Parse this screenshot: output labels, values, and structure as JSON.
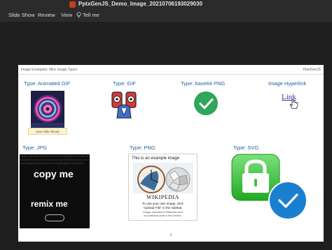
{
  "window": {
    "doc_title": "PptxGenJS_Demo_Image_20210706193029030"
  },
  "ribbon": {
    "tabs": [
      "Slide Show",
      "Review",
      "View"
    ],
    "tell_me": "Tell me"
  },
  "slide": {
    "header_left": "Image Examples: Misc Image Types",
    "header_right": "PptxGenJS",
    "labels": {
      "animated_gif": "Type: Animated GIF",
      "gif": "Type: GIF",
      "base64_png": "Type: base64 PNG",
      "hyperlink": "Image Hyperlink",
      "jpg": "Type: JPG",
      "png": "Type: PNG",
      "svg": "Type: SVG"
    },
    "gif_caption": "(use slide Show)",
    "hyperlink_text": "Link",
    "jpg": {
      "copy": "copy me",
      "remix": "remix me",
      "noise": "mebe.enilhsaconba.mercoms.broadcastme.mercoms.broadcastme.mercoms.hurscome.rjpme.filesharome.mercoms.broadcastme.mercoms.broadcastme.mercoms"
    },
    "png": {
      "top_text": "This is an example image",
      "wikipedia": "WIKIPEDIA",
      "line1": "To use your own image, click",
      "line2": "\"Upload File\" in the sidebar.",
      "tiny1": "Images uploaded to Wikipedia must",
      "tiny2": "be published under a free license."
    },
    "page_number": "1"
  },
  "colors": {
    "label_blue": "#1f5fa6",
    "check_green": "#2fa65a",
    "svg_green": "#3cc43c",
    "svg_blue_circle": "#1a7fd1"
  }
}
